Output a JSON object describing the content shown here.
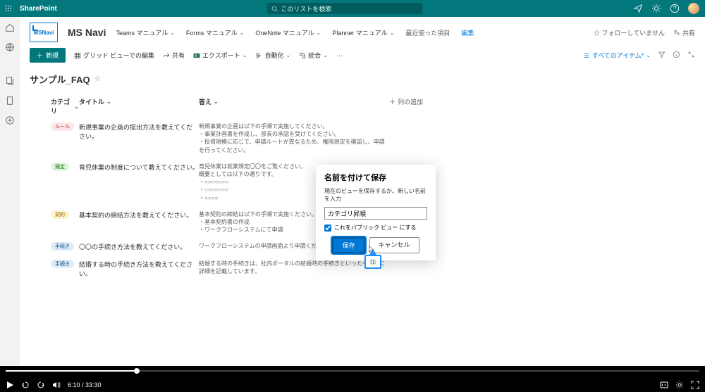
{
  "topbar": {
    "brand": "SharePoint",
    "search_placeholder": "このリストを検索"
  },
  "site": {
    "logo_text": "MSNavi",
    "name": "MS Navi",
    "nav": [
      {
        "label": "Teams マニュアル"
      },
      {
        "label": "Forms マニュアル"
      },
      {
        "label": "OneNote マニュアル"
      },
      {
        "label": "Planner マニュアル"
      }
    ],
    "recent": "最近使った項目",
    "edit": "編集",
    "follow": "☆ フォローしていません",
    "share": "共有"
  },
  "cmdbar": {
    "new": "新規",
    "grid": "グリッド ビューでの編集",
    "share": "共有",
    "export": "エクスポート",
    "automate": "自動化",
    "integrate": "統合",
    "views": "すべてのアイテム*"
  },
  "list": {
    "title": "サンプル_FAQ",
    "headers": {
      "category": "カテゴリ",
      "title": "タイトル",
      "answer": "答え",
      "add": "列の追加"
    },
    "rows": [
      {
        "tagClass": "tag-red",
        "tag": "ルール",
        "title": "新規事業の企画の提出方法を教えてください。",
        "answer": "新規事業の企画は以下の手順で実施してください。\n・事業計画書を作成し、部長の承認を受けてください。\n・投資規模に応じて、申請ルートが異なるため、権限規定を確認し、申請を行ってください。"
      },
      {
        "tagClass": "tag-green",
        "tag": "規定",
        "title": "育児休業の制度について教えてください。",
        "answer": "育児休業は就業規定〇〇をご覧ください。\n概要としては以下の通りです。\n・○○○○○○○\n・○○○○○○○\n・○○○○"
      },
      {
        "tagClass": "tag-yellow",
        "tag": "契約",
        "title": "基本契約の締結方法を教えてください。",
        "answer": "基本契約の締結は以下の手順で実施ください。\n・基本契約書の作成\n・ワークフローシステムにて申請"
      },
      {
        "tagClass": "tag-blue",
        "tag": "手続き",
        "title": "〇〇の手続き方法を教えてください。",
        "answer": "ワークフローシステムの申請画面より申請ください。"
      },
      {
        "tagClass": "tag-blue",
        "tag": "手続き",
        "title": "結婚する時の手続き方法を教えてください。",
        "answer": "結婚する時の手続きは、社内ポータルの結婚時の手続きといったページに詳細を記載しています。"
      }
    ]
  },
  "modal": {
    "title": "名前を付けて保存",
    "desc": "現在のビューを保存するか、新しい名前を入力",
    "value": "カテゴリ昇順",
    "public": "これをパブリック ビュー にする",
    "save": "保存",
    "cancel": "キャンセル"
  },
  "callout": "⑮",
  "player": {
    "time": "6:10 / 33:30"
  }
}
